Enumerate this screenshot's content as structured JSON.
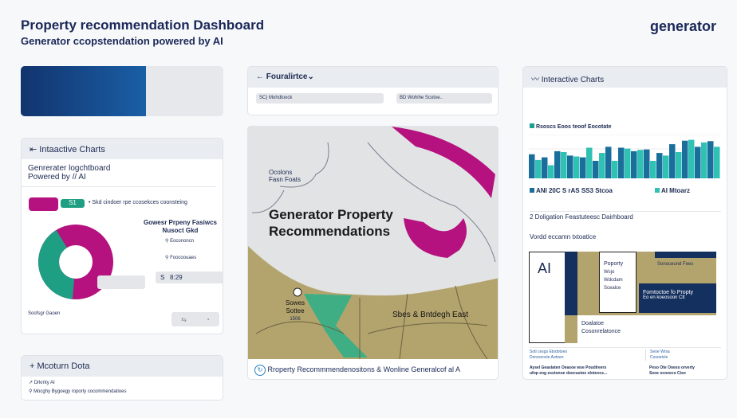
{
  "header": {
    "title": "Property recommendation Dashboard",
    "subtitle": "Generator ccopstendation powered by AI",
    "logo": "generator"
  },
  "left_card": {
    "title": "Intaactive Charts",
    "heading1": "Genrerater logchtboard",
    "heading2": "Powered by // AI",
    "toggle_label": "• Skd cindoer rpe ccosekces coonsteing",
    "tag": "S1",
    "features_title": "Gowesr Prpeny Fasiwcs",
    "features_sub": "Nusoct Gkd",
    "items": [
      "Eocononcn",
      "Foocoouaes"
    ],
    "value_prefix": "S",
    "value": "8:29",
    "footer": "Soofsgr Gaoen",
    "btn1": "⇆",
    "btn2": "◔"
  },
  "data_card": {
    "title": "Mcoturn Dota",
    "items": [
      "Drkmty AI",
      "Mocghy Bygoegy roporly cocommendatioes"
    ]
  },
  "filter_card": {
    "title": "Fouralirtce",
    "field1": "Mohdtoock",
    "field1_icon": "SC)",
    "field2": "Wohihe Scotoe..",
    "field2_icon": "BD"
  },
  "map": {
    "heading1": "Generator Property",
    "heading2": "Recommendations",
    "label1a": "Ocolons",
    "label1b": "Fasn Foats",
    "label2a": "Sowes",
    "label2b": "Sottee",
    "label2c": "1506",
    "label3": "Sbes & Bntdegh East",
    "footer": "Rroperty Recommmendenositons & Wonline Generalcof al A"
  },
  "right_card": {
    "title": "Interactive Charts",
    "chart_caption": "Rsoscs Eoos teoof Eocotate",
    "legend1": "ANI 20C S rAS SS3 Stcoa",
    "legend2": "AI Mtoarz",
    "section1": "2 Doligation Feastuteesc Dairhboard",
    "section2": "Vordd eccamn txtoatice",
    "ai_label": "AI",
    "prop_box": [
      "Poporty",
      "Wsjo",
      "Wdcdam",
      "Scealce"
    ],
    "region_label": "Sonoceund Fees",
    "dark_box1": "Fomtoctoe fo Propty",
    "dark_box2": "Eo en koeosoon Ctt",
    "below1": "Doalatoe",
    "below2": "Cosonrelatonce",
    "foot_left1": "Sotl cesgs Etodotoes",
    "foot_left2": "Dorzoeocte Aotoen",
    "foot_left3": "Aysel Geaslaten Oeasoe wse Poudlreers",
    "foot_left4": "ufop eog esstonoe doecuutoe oloteocs...",
    "foot_right1": "Seoe Wrsa",
    "foot_right2": "Cosoetcle",
    "foot_right3": "Peso Ote Ooeso orverty",
    "foot_right4": "Seoe ocoeeco Ciso"
  },
  "chart_data": {
    "type": "bar",
    "title": "Rsoscs Eoos teoof Eocotate",
    "series": [
      {
        "name": "ANI 20C S rAS SS3 Stcoa",
        "color": "#1a6e9c",
        "values": [
          55,
          48,
          62,
          52,
          48,
          40,
          72,
          70,
          62,
          66,
          58,
          78,
          86,
          72,
          85
        ]
      },
      {
        "name": "AI Mtoarz",
        "color": "#2fc1b3",
        "values": [
          42,
          30,
          60,
          50,
          70,
          58,
          40,
          68,
          65,
          40,
          52,
          60,
          88,
          82,
          72
        ]
      }
    ],
    "ylim": [
      0,
      100
    ]
  },
  "colors": {
    "navy": "#1a2858",
    "magenta": "#b5117f",
    "teal": "#1e9e82"
  }
}
